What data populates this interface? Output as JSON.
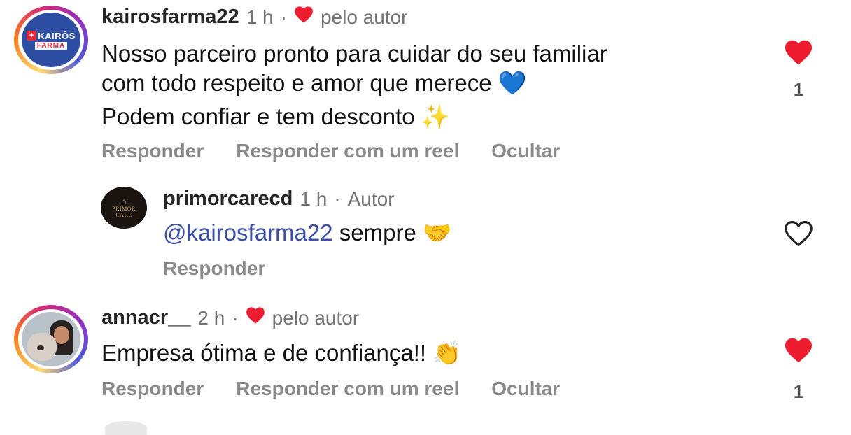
{
  "comments": [
    {
      "username": "kairosfarma22",
      "time": "1 h",
      "separator": "·",
      "liked_by_author_label": "pelo autor",
      "text_line1": "Nosso parceiro pronto para cuidar do seu familiar",
      "text_line2": "com todo respeito e amor que merece",
      "text_line3": "Podem confiar e tem desconto",
      "emoji_heart": "💙",
      "emoji_sparkles": "✨",
      "avatar_logo_top": "KAIRÓS",
      "avatar_logo_bottom": "FARMA",
      "actions": [
        "Responder",
        "Responder com um reel",
        "Ocultar"
      ],
      "like_count": "1",
      "liked": true
    },
    {
      "username": "primorcarecd",
      "time": "1 h",
      "separator": "·",
      "author_label": "Autor",
      "mention": "@kairosfarma22",
      "text": "sempre",
      "emoji": "🤝",
      "avatar_logo_top": "PRIMOR",
      "avatar_logo_bottom": "CARE",
      "actions": [
        "Responder"
      ],
      "liked": false
    },
    {
      "username": "annacr__",
      "time": "2 h",
      "separator": "·",
      "liked_by_author_label": "pelo autor",
      "text": "Empresa ótima e de confiança!!",
      "emoji": "👏",
      "actions": [
        "Responder",
        "Responder com um reel",
        "Ocultar"
      ],
      "like_count": "1",
      "liked": true
    }
  ],
  "icons": {
    "heart_filled": "heart-filled-icon",
    "heart_outline": "heart-outline-icon"
  },
  "colors": {
    "like_red": "#ed1c2e",
    "mention_blue": "#3b4fa8",
    "muted_text": "#737373",
    "action_text": "#8a8a8a"
  }
}
